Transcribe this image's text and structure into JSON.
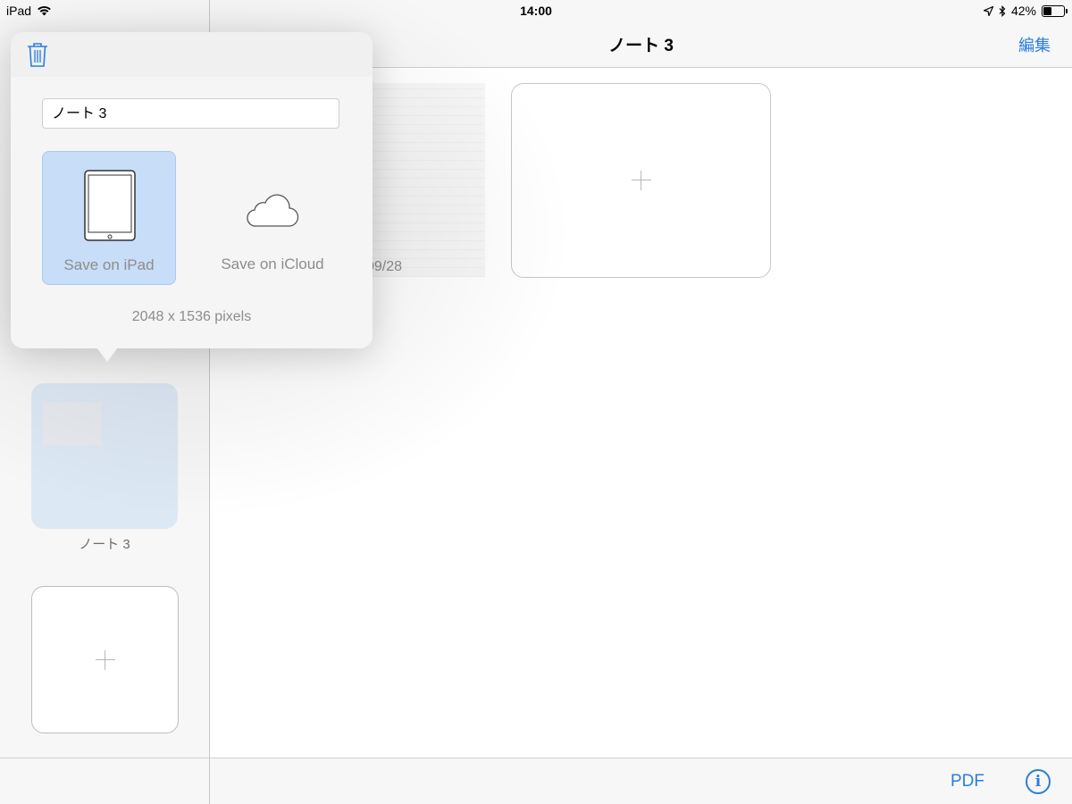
{
  "status_bar": {
    "device": "iPad",
    "time": "14:00",
    "battery": "42%",
    "battery_level": 0.42,
    "icons": [
      "wifi-icon",
      "location-arrow-icon",
      "bluetooth-icon",
      "battery-icon"
    ]
  },
  "nav": {
    "title": "ノート 3",
    "edit_label": "編集"
  },
  "main": {
    "page_date": "09/28"
  },
  "sidebar": {
    "notes": [
      {
        "label": "ノート 3"
      }
    ]
  },
  "popover": {
    "name_value": "ノート 3",
    "save_ipad_label": "Save on iPad",
    "save_icloud_label": "Save on iCloud",
    "pixel_size": "2048 x 1536 pixels",
    "selected": "Save on iPad"
  },
  "bottom_bar": {
    "pdf_label": "PDF",
    "info_label": "i"
  },
  "colors": {
    "accent": "#2a7de1",
    "selected_bg": "#c8ddf7"
  }
}
